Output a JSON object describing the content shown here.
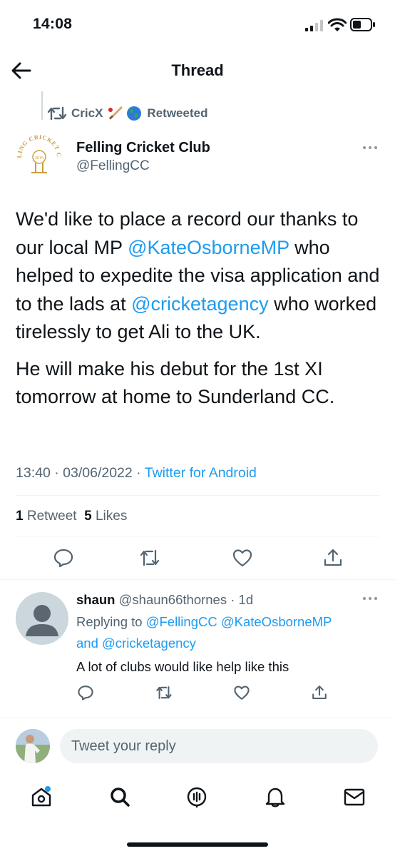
{
  "status_bar": {
    "time": "14:08"
  },
  "header": {
    "title": "Thread"
  },
  "retweet": {
    "by": "CricX",
    "label": "Retweeted"
  },
  "tweet": {
    "author_name": "Felling Cricket Club",
    "author_handle": "@FellingCC",
    "logo_text": "FELLING CRICKET CLUB",
    "logo_year": "2019",
    "text_p1_a": "We'd like to place a record our thanks to our local MP ",
    "mention_1": "@KateOsborneMP",
    "text_p1_b": " who helped to expedite the visa application and to the lads at ",
    "mention_2": "@cricketagency",
    "text_p1_c": " who worked tirelessly to get Ali to the UK.",
    "text_p2": "He will make his debut for the 1st XI tomorrow at home to Sunderland CC.",
    "time": "13:40",
    "date": "03/06/2022",
    "source": "Twitter for Android",
    "retweet_count": "1",
    "retweet_label": "Retweet",
    "like_count": "5",
    "like_label": "Likes"
  },
  "reply": {
    "author_name": "shaun",
    "author_handle": "@shaun66thornes",
    "age": "1d",
    "replying_to_label": "Replying to",
    "replying_to_1": "@FellingCC",
    "replying_to_2": "@KateOsborneMP",
    "and_label": "and",
    "replying_to_3": "@cricketagency",
    "text": "A lot of clubs would like help like this"
  },
  "composer": {
    "placeholder": "Tweet your reply"
  },
  "colors": {
    "accent": "#1d9bf0",
    "text": "#0f1419",
    "secondary": "#536471",
    "logo_gold": "#c8a13c"
  },
  "icons": [
    "back-arrow-icon",
    "retweet-icon",
    "cricket-bat-emoji-icon",
    "globe-emoji-icon",
    "more-icon",
    "reply-icon",
    "like-icon",
    "share-icon",
    "home-icon",
    "search-icon",
    "spaces-icon",
    "notifications-icon",
    "messages-icon"
  ]
}
